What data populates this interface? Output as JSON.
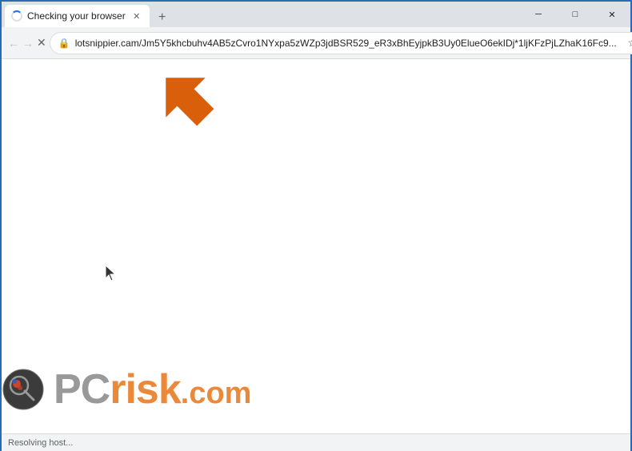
{
  "titlebar": {
    "tab_label": "Checking your browser",
    "new_tab_symbol": "+",
    "minimize_symbol": "─",
    "maximize_symbol": "□",
    "close_symbol": "✕"
  },
  "toolbar": {
    "back_symbol": "←",
    "forward_symbol": "→",
    "reload_symbol": "✕",
    "url": "lotsnippier.cam/Jm5Y5khcbuhv4AB5zCvro1NYxpa5zWZp3jdBSR529_eR3xBhEyjpkB3Uy0ElueO6ekIDj*1ljKFzPjLZhaK16Fc9...",
    "menu_symbol": "⋮"
  },
  "statusbar": {
    "text": "Resolving host..."
  },
  "watermark": {
    "pc_text": "PC",
    "risk_text": "risk",
    "dotcom_text": ".com"
  }
}
